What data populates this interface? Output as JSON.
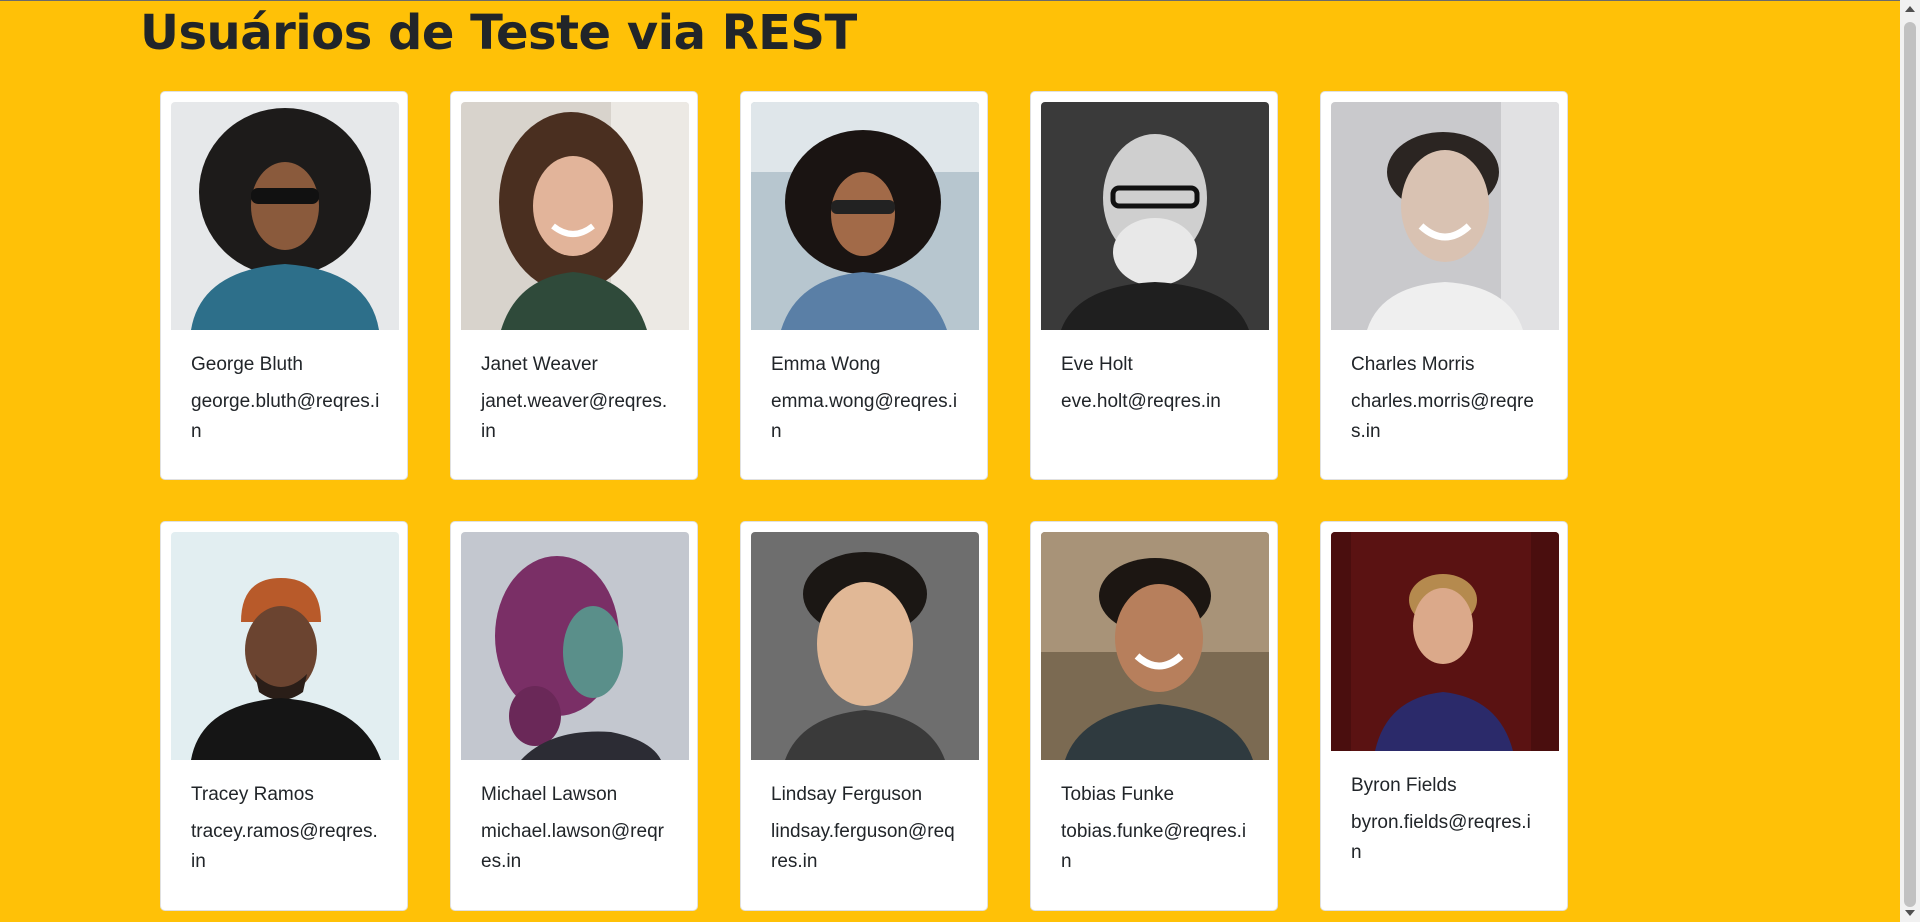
{
  "page": {
    "title": "Usuários de Teste via REST",
    "background_color": "#ffc107"
  },
  "users": [
    {
      "name": "George Bluth",
      "email": "george.bluth@reqres.in",
      "photo_icon": "avatar-photo"
    },
    {
      "name": "Janet Weaver",
      "email": "janet.weaver@reqres.in",
      "photo_icon": "avatar-photo"
    },
    {
      "name": "Emma Wong",
      "email": "emma.wong@reqres.in",
      "photo_icon": "avatar-photo"
    },
    {
      "name": "Eve Holt",
      "email": "eve.holt@reqres.in",
      "photo_icon": "avatar-photo"
    },
    {
      "name": "Charles Morris",
      "email": "charles.morris@reqres.in",
      "photo_icon": "avatar-photo"
    },
    {
      "name": "Tracey Ramos",
      "email": "tracey.ramos@reqres.in",
      "photo_icon": "avatar-photo"
    },
    {
      "name": "Michael Lawson",
      "email": "michael.lawson@reqres.in",
      "photo_icon": "avatar-photo"
    },
    {
      "name": "Lindsay Ferguson",
      "email": "lindsay.ferguson@reqres.in",
      "photo_icon": "avatar-photo"
    },
    {
      "name": "Tobias Funke",
      "email": "tobias.funke@reqres.in",
      "photo_icon": "avatar-photo"
    },
    {
      "name": "Byron Fields",
      "email": "byron.fields@reqres.in",
      "photo_icon": "avatar-photo"
    }
  ]
}
